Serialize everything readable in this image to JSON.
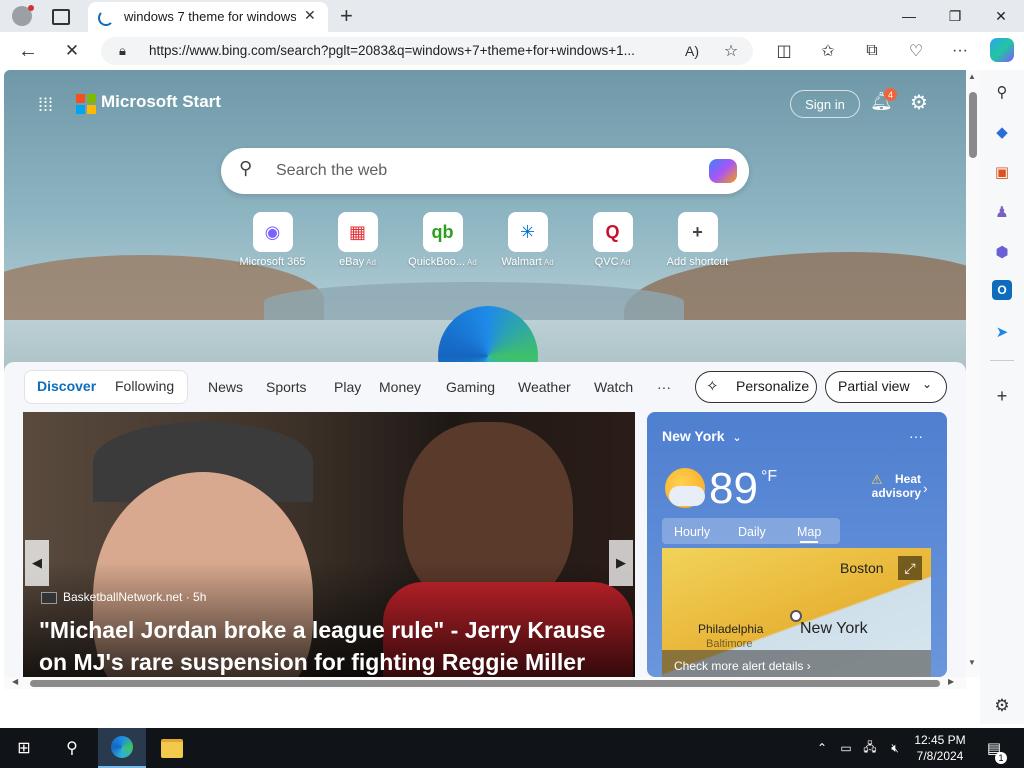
{
  "browser": {
    "tab_title": "windows 7 theme for windows 10",
    "new_tab_symbol": "+",
    "url": "https://www.bing.com/search?pglt=2083&q=windows+7+theme+for+windows+1...",
    "window_controls": {
      "minimize": "—",
      "restore": "❐",
      "close": "✕"
    }
  },
  "page": {
    "brand": "Microsoft Start",
    "sign_in": "Sign in",
    "notification_count": "4",
    "search_placeholder": "Search the web",
    "shortcuts": [
      {
        "label": "Microsoft 365",
        "ad": "",
        "icon": "m365-icon",
        "color": "#7b61ff"
      },
      {
        "label": "eBay",
        "ad": "Ad",
        "icon": "ebay-icon",
        "color": "#e53238"
      },
      {
        "label": "QuickBoo...",
        "ad": "Ad",
        "icon": "quickbooks-icon",
        "color": "#2ca01c"
      },
      {
        "label": "Walmart",
        "ad": "Ad",
        "icon": "walmart-icon",
        "color": "#0071ce"
      },
      {
        "label": "QVC",
        "ad": "Ad",
        "icon": "qvc-icon",
        "color": "#c8102e"
      },
      {
        "label": "Add shortcut",
        "ad": "",
        "icon": "plus-icon",
        "color": "#444444"
      }
    ],
    "feed_tabs": {
      "discover": "Discover",
      "following": "Following"
    },
    "nav": [
      "News",
      "Sports",
      "Play",
      "Money",
      "Gaming",
      "Weather",
      "Watch",
      "···"
    ],
    "personalize": "Personalize",
    "partial_view": "Partial view",
    "hero": {
      "source": "BasketballNetwork.net · 5h",
      "headline": "\"Michael Jordan broke a league rule\" - Jerry Krause on MJ's rare suspension for fighting Reggie Miller"
    },
    "weather": {
      "city": "New York",
      "temperature": "89",
      "unit": "°F",
      "alert": "Heat advisory",
      "tabs": [
        "Hourly",
        "Daily",
        "Map"
      ],
      "active_tab": "Map",
      "map_labels": {
        "boston": "Boston",
        "philadelphia": "Philadelphia",
        "new_york": "New York",
        "baltimore": "Baltimore"
      },
      "cta": "Check more alert details ›"
    }
  },
  "taskbar": {
    "time": "12:45 PM",
    "date": "7/8/2024",
    "notification_count": "1"
  },
  "colors": {
    "accent": "#0f6cbd",
    "taskbar_bg": "#101317",
    "weather_bg": "#4f7fd0"
  }
}
